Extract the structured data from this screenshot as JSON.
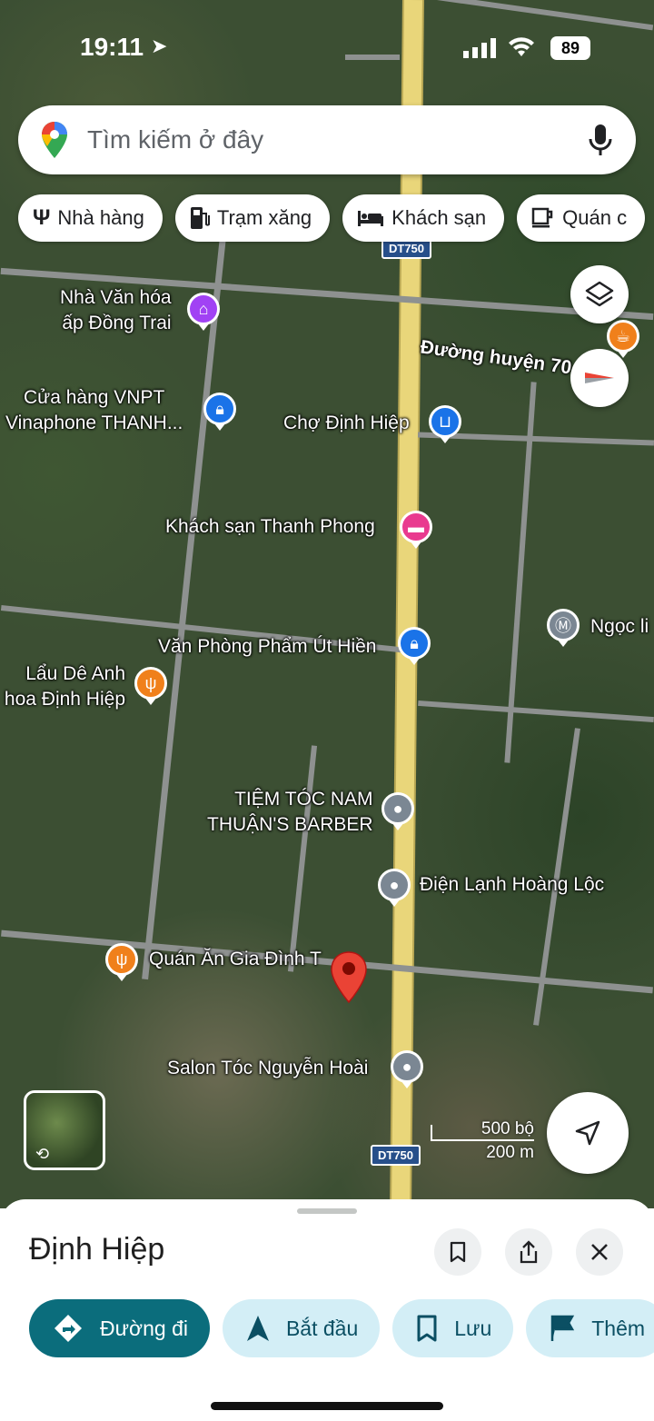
{
  "status_bar": {
    "time": "19:11",
    "battery": "89"
  },
  "search": {
    "placeholder": "Tìm kiếm ở đây"
  },
  "chips": [
    {
      "label": "Nhà hàng",
      "icon": "fork-knife-icon"
    },
    {
      "label": "Trạm xăng",
      "icon": "gas-station-icon"
    },
    {
      "label": "Khách sạn",
      "icon": "bed-icon"
    },
    {
      "label": "Quán c",
      "icon": "coffee-cup-icon"
    }
  ],
  "map": {
    "road_shields": [
      "DT750",
      "DT750"
    ],
    "road_name": "Đường huyện 70",
    "pois": [
      {
        "label": "Nhà Văn hóa\nấp Đồng Trai",
        "icon": "museum-icon",
        "color": "#a142f4"
      },
      {
        "label": "Cửa hàng VNPT\nVinaphone THANH...",
        "icon": "shopping-bag-icon",
        "color": "#1a73e8"
      },
      {
        "label": "Chợ Định Hiệp",
        "icon": "shopping-cart-icon",
        "color": "#1a73e8"
      },
      {
        "label": "Khách sạn Thanh Phong",
        "icon": "bed-icon",
        "color": "#e93a8f"
      },
      {
        "label": "Ngọc li",
        "icon": "landmark-icon",
        "color": "#7b8793"
      },
      {
        "label": "Văn Phòng Phẩm Út Hiền",
        "icon": "shopping-bag-icon",
        "color": "#1a73e8"
      },
      {
        "label": "Lẩu Dê Anh\nhoa Định Hiệp",
        "icon": "fork-knife-icon",
        "color": "#f0801b"
      },
      {
        "label": "TIỆM TÓC NAM\nTHUẬN'S BARBER",
        "icon": "pin-dot-icon",
        "color": "#7b8793"
      },
      {
        "label": "Điện Lạnh Hoàng Lộc",
        "icon": "pin-dot-icon",
        "color": "#7b8793"
      },
      {
        "label": "Quán Ăn Gia Đình T",
        "icon": "fork-knife-icon",
        "color": "#f0801b"
      },
      {
        "label": "Salon Tóc Nguyễn Hoài",
        "icon": "pin-dot-icon",
        "color": "#7b8793"
      }
    ],
    "scale": {
      "top": "500 bộ",
      "bottom": "200 m"
    }
  },
  "sheet": {
    "title": "Định Hiệp",
    "actions": [
      {
        "label": "Đường đi",
        "icon": "directions-icon"
      },
      {
        "label": "Bắt đầu",
        "icon": "navigation-arrow-icon"
      },
      {
        "label": "Lưu",
        "icon": "bookmark-icon"
      },
      {
        "label": "Thêm",
        "icon": "flag-icon"
      }
    ]
  },
  "colors": {
    "accent": "#0b6d7c",
    "chip_bg": "#d3eef6",
    "main_road": "#e9d67a",
    "pin_red": "#ea4335"
  }
}
